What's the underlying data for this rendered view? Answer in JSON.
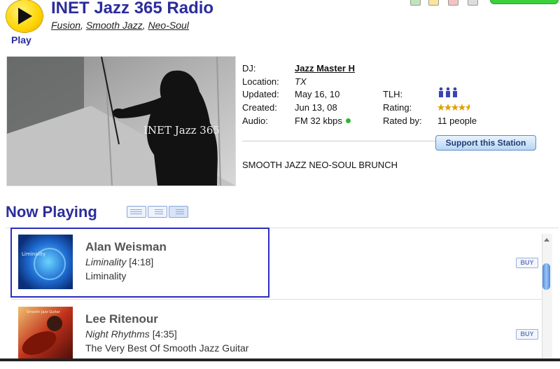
{
  "station": {
    "play_label": "Play",
    "name": "INET Jazz 365 Radio",
    "genres": [
      "Fusion",
      "Smooth Jazz",
      "Neo-Soul"
    ],
    "image_caption": "INET Jazz 365",
    "description": "SMOOTH JAZZ NEO-SOUL BRUNCH",
    "support_button": "Support this Station"
  },
  "details": {
    "dj_label": "DJ:",
    "dj_value": "Jazz Master H",
    "location_label": "Location:",
    "location_value": "TX",
    "updated_label": "Updated:",
    "updated_value": "May 16, 10",
    "created_label": "Created:",
    "created_value": "Jun 13, 08",
    "audio_label": "Audio:",
    "audio_value": "FM 32 kbps",
    "tlh_label": "TLH:",
    "tlh_icon": "listeners-icon",
    "rating_label": "Rating:",
    "rating_stars": 4.5,
    "rated_by_label": "Rated by:",
    "rated_by_value": "11 people"
  },
  "now_playing": {
    "title": "Now Playing",
    "buy_label": "BUY",
    "tracks": [
      {
        "artist": "Alan Weisman",
        "song": "Liminality",
        "duration": "[4:18]",
        "album": "Liminality",
        "cover_text": "Liminality"
      },
      {
        "artist": "Lee Ritenour",
        "song": "Night Rhythms",
        "duration": "[4:35]",
        "album": "The Very Best Of Smooth Jazz Guitar",
        "cover_text": "Smooth Jazz Guitar"
      }
    ]
  },
  "colors": {
    "title": "#2b2d9c",
    "selection": "#2b2dbf",
    "status_online": "#2fb52f",
    "star": "#e0a000"
  }
}
